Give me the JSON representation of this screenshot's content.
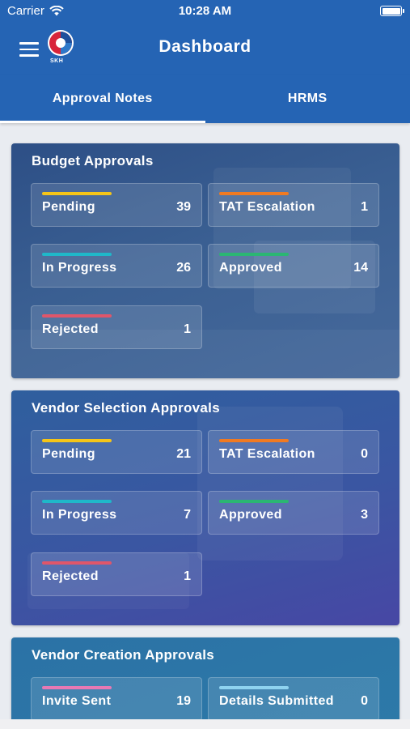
{
  "status_bar": {
    "carrier": "Carrier",
    "time": "10:28 AM"
  },
  "header": {
    "title": "Dashboard",
    "logo_text": "SKH"
  },
  "tabs": [
    {
      "label": "Approval Notes",
      "active": true
    },
    {
      "label": "HRMS",
      "active": false
    }
  ],
  "colors": {
    "primary": "#2564b4",
    "pending": "#f5c518",
    "tat_escalation": "#f07a22",
    "in_progress": "#1fb8c9",
    "approved": "#2bb673",
    "rejected": "#e0566a",
    "invite_sent": "#e879b4",
    "details_submitted": "#8fd3f0"
  },
  "cards": [
    {
      "title": "Budget Approvals",
      "tiles": [
        {
          "label": "Pending",
          "count": "39"
        },
        {
          "label": "TAT Escalation",
          "count": "1"
        },
        {
          "label": "In Progress",
          "count": "26"
        },
        {
          "label": "Approved",
          "count": "14"
        },
        {
          "label": "Rejected",
          "count": "1"
        }
      ]
    },
    {
      "title": "Vendor Selection Approvals",
      "tiles": [
        {
          "label": "Pending",
          "count": "21"
        },
        {
          "label": "TAT Escalation",
          "count": "0"
        },
        {
          "label": "In Progress",
          "count": "7"
        },
        {
          "label": "Approved",
          "count": "3"
        },
        {
          "label": "Rejected",
          "count": "1"
        }
      ]
    },
    {
      "title": "Vendor Creation Approvals",
      "tiles": [
        {
          "label": "Invite Sent",
          "count": "19"
        },
        {
          "label": "Details Submitted",
          "count": "0"
        }
      ]
    }
  ]
}
